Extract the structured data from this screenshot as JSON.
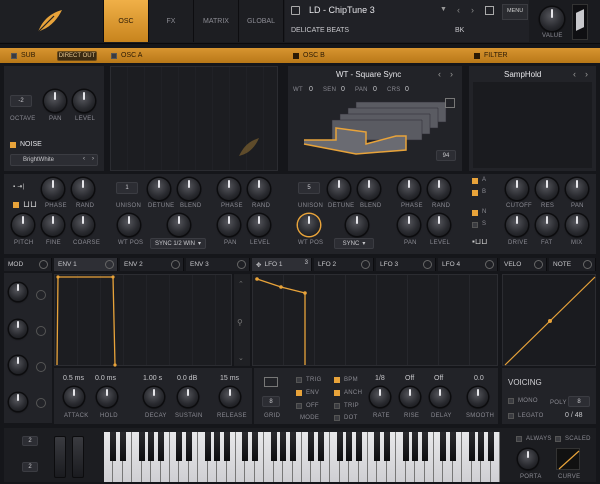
{
  "top": {
    "tabs": [
      {
        "label": "OSC",
        "active": true
      },
      {
        "label": "FX",
        "active": false
      },
      {
        "label": "MATRIX",
        "active": false
      },
      {
        "label": "GLOBAL",
        "active": false
      }
    ],
    "preset_name": "LD - ChipTune 3",
    "bank_name": "DELICATE BEATS",
    "author": "BK",
    "menu_label": "MENU",
    "volume_label": "VALUE"
  },
  "sections": {
    "sub": "SUB",
    "direct_out": "DIRECT OUT",
    "osc_a": "OSC A",
    "osc_b": "OSC B",
    "filter": "FILTER",
    "noise": "NOISE"
  },
  "sub_osc": {
    "octave_value": "-2",
    "labels": [
      "OCTAVE",
      "PAN",
      "LEVEL"
    ]
  },
  "noise": {
    "type": "BrightWhite"
  },
  "wavetable": {
    "name": "WT - Square Sync",
    "row_labels": [
      "WT",
      "SEN",
      "PAN",
      "CRS"
    ],
    "row_values": [
      "0",
      "0",
      "0",
      "0"
    ],
    "frame": "94"
  },
  "filter": {
    "type": "SampHold"
  },
  "osc_a": {
    "phase_label": "PHASE",
    "rand_label": "RAND",
    "unison_label": "UNISON",
    "detune_label": "DETUNE",
    "blend_label": "BLEND",
    "unison_value": "1",
    "pitch_label": "PITCH",
    "fine_label": "FINE",
    "coarse_label": "COARSE",
    "wtpos_label": "WT POS",
    "warp_value": "SYNC 1/2 WIN",
    "pan_label": "PAN",
    "level_label": "LEVEL"
  },
  "osc_b": {
    "unison_value": "5",
    "warp_value": "SYNC",
    "route_a": "A",
    "route_b": "B",
    "route_n": "N",
    "route_s": "S"
  },
  "filter_knobs": [
    "CUTOFF",
    "RES",
    "PAN",
    "DRIVE",
    "FAT",
    "MIX"
  ],
  "mod_tabs": [
    {
      "label": "MOD",
      "active": false
    },
    {
      "label": "ENV 1",
      "active": true
    },
    {
      "label": "ENV 2",
      "active": false
    },
    {
      "label": "ENV 3",
      "active": false
    },
    {
      "label": "LFO 1",
      "active": true,
      "badge": "3"
    },
    {
      "label": "LFO 2",
      "active": false
    },
    {
      "label": "LFO 3",
      "active": false
    },
    {
      "label": "LFO 4",
      "active": false
    },
    {
      "label": "VELO",
      "active": false
    },
    {
      "label": "NOTE",
      "active": false
    }
  ],
  "env": {
    "attack": {
      "label": "ATTACK",
      "value": "0.5 ms"
    },
    "hold": {
      "label": "HOLD",
      "value": "0.0 ms"
    },
    "decay": {
      "label": "DECAY",
      "value": "1.00 s"
    },
    "sustain": {
      "label": "SUSTAIN",
      "value": "0.0 dB"
    },
    "release": {
      "label": "RELEASE",
      "value": "15 ms"
    }
  },
  "lfo": {
    "grid_label": "GRID",
    "grid_value": "8",
    "mode_labels": [
      "TRIG",
      "ENV",
      "OFF"
    ],
    "mode_title": "MODE",
    "bpm_labels": [
      "BPM",
      "ANCH",
      "TRIP",
      "DOT"
    ],
    "rate": {
      "label": "RATE",
      "value": "1/8"
    },
    "rise": {
      "label": "RISE",
      "value": "Off"
    },
    "delay": {
      "label": "DELAY",
      "value": "Off"
    },
    "smooth": {
      "label": "SMOOTH",
      "value": "0.0"
    }
  },
  "voicing": {
    "title": "VOICING",
    "mono": "MONO",
    "legato": "LEGATO",
    "poly_label": "POLY",
    "poly_value": "8",
    "count": "0 / 48"
  },
  "keyboard": {
    "pitch_value": "2",
    "mod_value": "2",
    "always": "ALWAYS",
    "scaled": "SCALED",
    "porta": "PORTA",
    "curve": "CURVE"
  },
  "colors": {
    "accent": "#e8a33a",
    "panel": "#222328",
    "background": "#15161a"
  }
}
